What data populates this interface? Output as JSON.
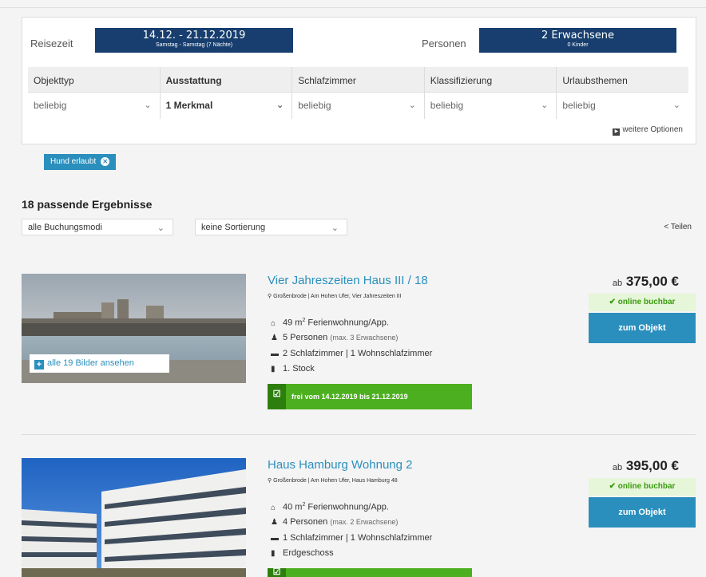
{
  "search": {
    "reisezeit_label": "Reisezeit",
    "date_range": "14.12. - 21.12.2019",
    "date_sub": "Samstag - Samstag (7 Nächte)",
    "personen_label": "Personen",
    "persons": "2 Erwachsene",
    "persons_sub": "0 Kinder"
  },
  "filters": [
    {
      "label": "Objekttyp",
      "value": "beliebig"
    },
    {
      "label": "Ausstattung",
      "value": "1 Merkmal"
    },
    {
      "label": "Schlafzimmer",
      "value": "beliebig"
    },
    {
      "label": "Klassifizierung",
      "value": "beliebig"
    },
    {
      "label": "Urlaubsthemen",
      "value": "beliebig"
    }
  ],
  "more_options": "weitere Optionen",
  "active_tag": "Hund erlaubt",
  "results": {
    "count_title": "18 passende Ergebnisse",
    "booking_mode": "alle Buchungsmodi",
    "sorting": "keine Sortierung",
    "share": "Teilen"
  },
  "listings": [
    {
      "title": "Vier Jahreszeiten Haus III / 18",
      "location": "Großenbrode | Am Hohen Ufer, Vier Jahreszeiten III",
      "area": "49 m",
      "type": " Ferienwohnung/App.",
      "persons": "5 Personen",
      "persons_max": "(max. 3 Erwachsene)",
      "rooms": "2 Schlafzimmer | 1 Wohnschlafzimmer",
      "floor": "1. Stock",
      "availability": "frei vom 14.12.2019 bis 21.12.2019",
      "price_prefix": "ab",
      "price": "375,00 €",
      "online": "online buchbar",
      "button": "zum Objekt",
      "gallery": "alle 19 Bilder ansehen"
    },
    {
      "title": "Haus Hamburg Wohnung 2",
      "location": "Großenbrode | Am Hohen Ufer, Haus Hamburg 48",
      "area": "40 m",
      "type": " Ferienwohnung/App.",
      "persons": "4 Personen",
      "persons_max": "(max. 2 Erwachsene)",
      "rooms": "1 Schlafzimmer | 1 Wohnschlafzimmer",
      "floor": "Erdgeschoss",
      "price_prefix": "ab",
      "price": "395,00 €",
      "online": "online buchbar",
      "button": "zum Objekt"
    }
  ],
  "colors": {
    "navy": "#173e6e",
    "accent": "#2a8fbd",
    "green": "#4caf1f"
  }
}
